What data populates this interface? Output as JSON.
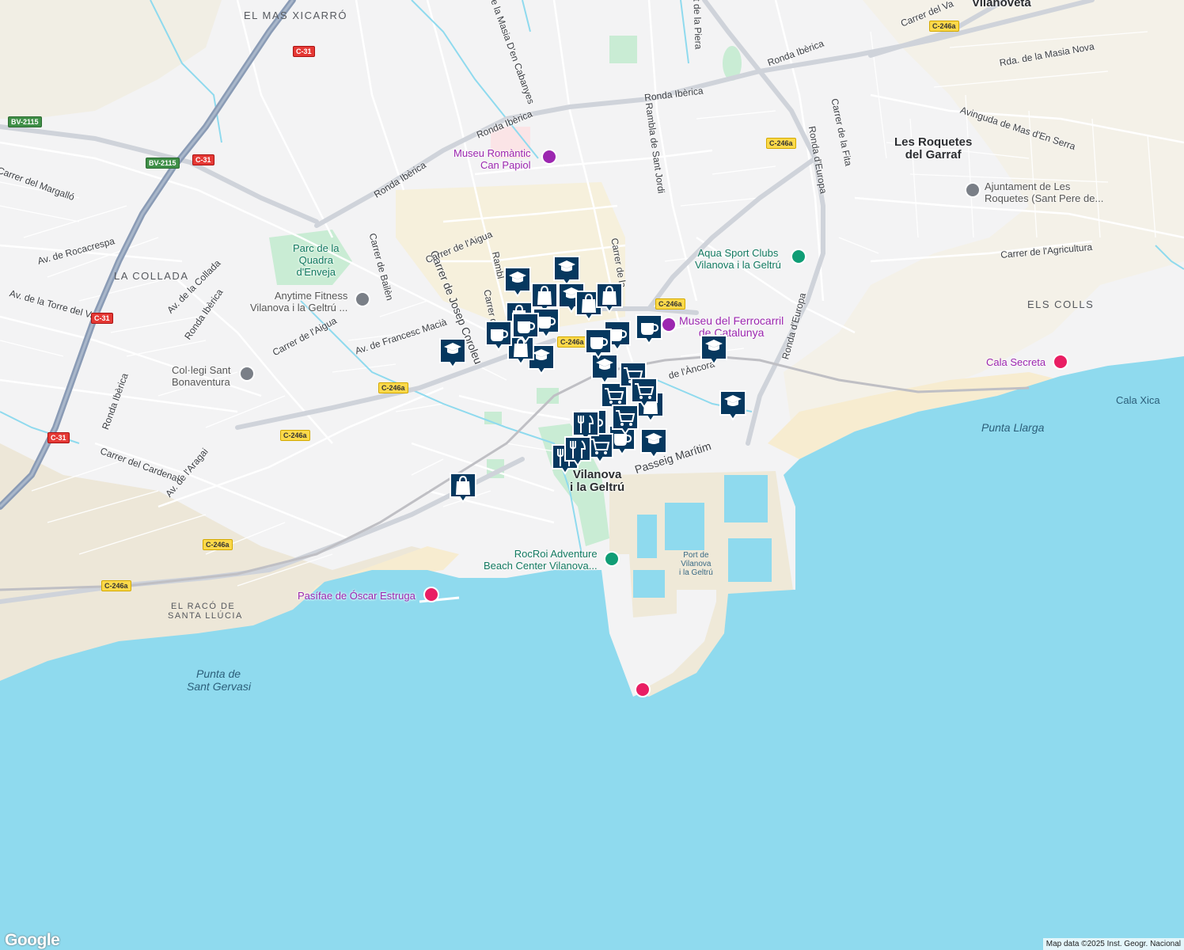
{
  "areas": [
    "EL MAS XICARRÓ",
    "LA COLLADA",
    "ELS COLLS",
    "EL RACÓ DE",
    "SANTA LLÚCIA"
  ],
  "towns": [
    {
      "line1": "Vilanoveta",
      "line2": ""
    },
    {
      "line1": "Les Roquetes",
      "line2": "del Garraf"
    },
    {
      "line1": "Vilanova",
      "line2": "i la Geltrú"
    }
  ],
  "streets": [
    "Ronda Ibèrica",
    "Rambla de Sant Jordi",
    "Carrer de la Fita",
    "Ronda d'Europa",
    "Avinguda de Mas d'En Serra",
    "Rda. de la Masia Nova",
    "Carrer de l'Agricultura",
    "Carrer del Margalló",
    "Av. de Rocacrespa",
    "Av. de la Torre del Vallès",
    "Av. de la Collada",
    "Carrer de Bailèn",
    "Carrer de Josep Coroleu",
    "Carrer de l'Aigua",
    "Av. de Francesc Macià",
    "Carrer del Cardenal",
    "Av. de l'Aragai",
    "Passeig Marítim",
    "Camí de la Masia D'en Cabanyes",
    "de l'Àncora",
    "Carrer de la",
    "Carrer del",
    "Rambl",
    "nt de la Piera",
    "Carrer del Va"
  ],
  "pois": [
    {
      "name": "Museu Romàntic",
      "name2": "Can Papiol",
      "kind": "purple"
    },
    {
      "name": "Parc de la",
      "name2": "Quadra",
      "name3": "d'Enveja",
      "kind": "green"
    },
    {
      "name": "Anytime Fitness",
      "name2": "Vilanova i la Geltrú ...",
      "kind": "gray"
    },
    {
      "name": "Col·legi Sant",
      "name2": "Bonaventura",
      "kind": "gray"
    },
    {
      "name": "Aqua Sport Clubs",
      "name2": "Vilanova i la Geltrú",
      "kind": "green"
    },
    {
      "name": "Museu del Ferrocarril",
      "name2": "de Catalunya",
      "kind": "purple"
    },
    {
      "name": "Ajuntament de Les",
      "name2": "Roquetes (Sant Pere de...",
      "kind": "gray"
    },
    {
      "name": "Cala Secreta",
      "name2": "",
      "kind": "purple"
    },
    {
      "name": "RocRoi Adventure",
      "name2": "Beach Center Vilanova...",
      "kind": "green"
    },
    {
      "name": "Pasífae de Óscar Estruga",
      "name2": "",
      "kind": "purple"
    }
  ],
  "sea_labels": [
    "Cala Xica",
    "Punta Llarga",
    "Punta de",
    "Sant Gervasi"
  ],
  "port": {
    "line1": "Port de",
    "line2": "Vilanova",
    "line3": "i la Geltrú"
  },
  "shields": [
    "C-31",
    "C-31",
    "C-31",
    "C-31",
    "BV-2115",
    "BV-2115",
    "C-246a",
    "C-246a",
    "C-246a",
    "C-246a",
    "C-246a",
    "C-246a",
    "C-246a",
    "C-246a"
  ],
  "markers": {
    "education": 8,
    "shopping": 7,
    "cafe": 8,
    "grocery": 5,
    "restaurant": 3
  },
  "colors": {
    "water": "#8fdaee",
    "land": "#f3f3f4",
    "beach": "#f7ecd0",
    "park": "#c9ecd4",
    "highway": "#8a9bb5",
    "marker": "#06385f"
  },
  "logo": "Google",
  "attribution": "Map data ©2025 Inst. Geogr. Nacional"
}
